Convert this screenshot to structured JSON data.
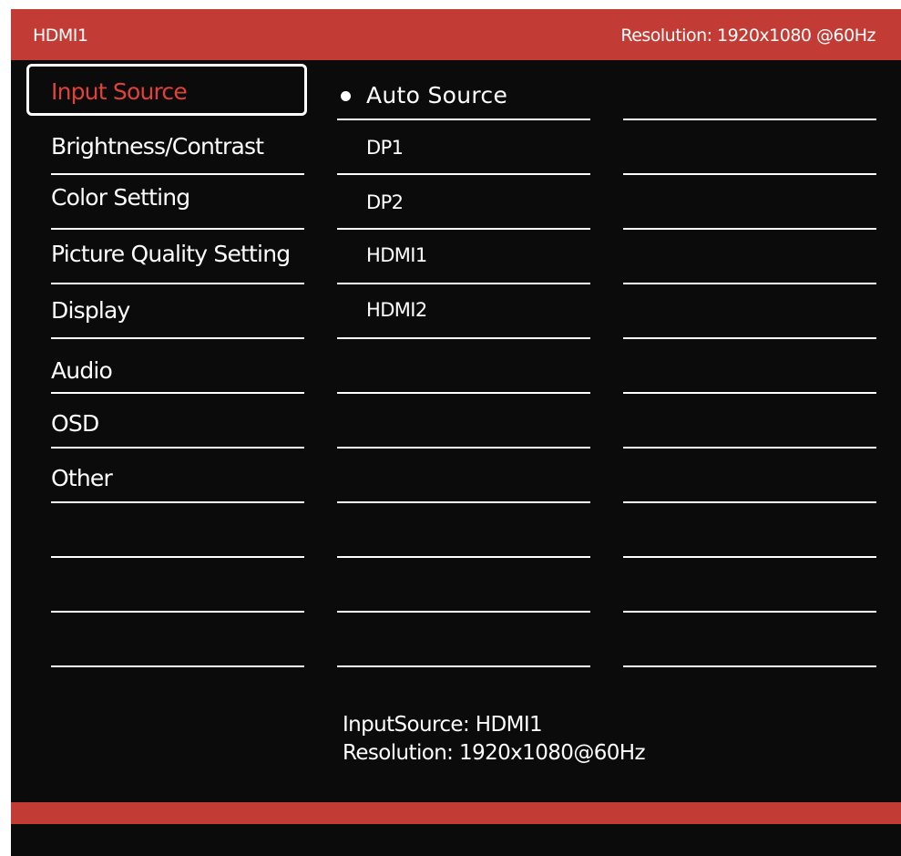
{
  "header": {
    "source": "HDMI1",
    "resolution": "Resolution: 1920x1080 @60Hz"
  },
  "menu": {
    "items": [
      {
        "label": "Input Source",
        "active": true
      },
      {
        "label": "Brightness/Contrast"
      },
      {
        "label": "Color Setting"
      },
      {
        "label": "Picture Quality Setting"
      },
      {
        "label": "Display"
      },
      {
        "label": "Audio"
      },
      {
        "label": "OSD"
      },
      {
        "label": "Other"
      },
      {
        "label": ""
      },
      {
        "label": ""
      },
      {
        "label": ""
      }
    ]
  },
  "submenu": {
    "items": [
      {
        "label": "Auto Source",
        "selected": true
      },
      {
        "label": "DP1"
      },
      {
        "label": "DP2"
      },
      {
        "label": "HDMI1"
      },
      {
        "label": "HDMI2"
      },
      {
        "label": ""
      },
      {
        "label": ""
      },
      {
        "label": ""
      },
      {
        "label": ""
      },
      {
        "label": ""
      },
      {
        "label": ""
      }
    ]
  },
  "info": {
    "input_source": "InputSource: HDMI1",
    "resolution": "Resolution: 1920x1080@60Hz"
  },
  "colors": {
    "accent": "#c33b35",
    "active_text": "#e0423a",
    "background": "#0b0b0b",
    "text": "#ffffff"
  }
}
